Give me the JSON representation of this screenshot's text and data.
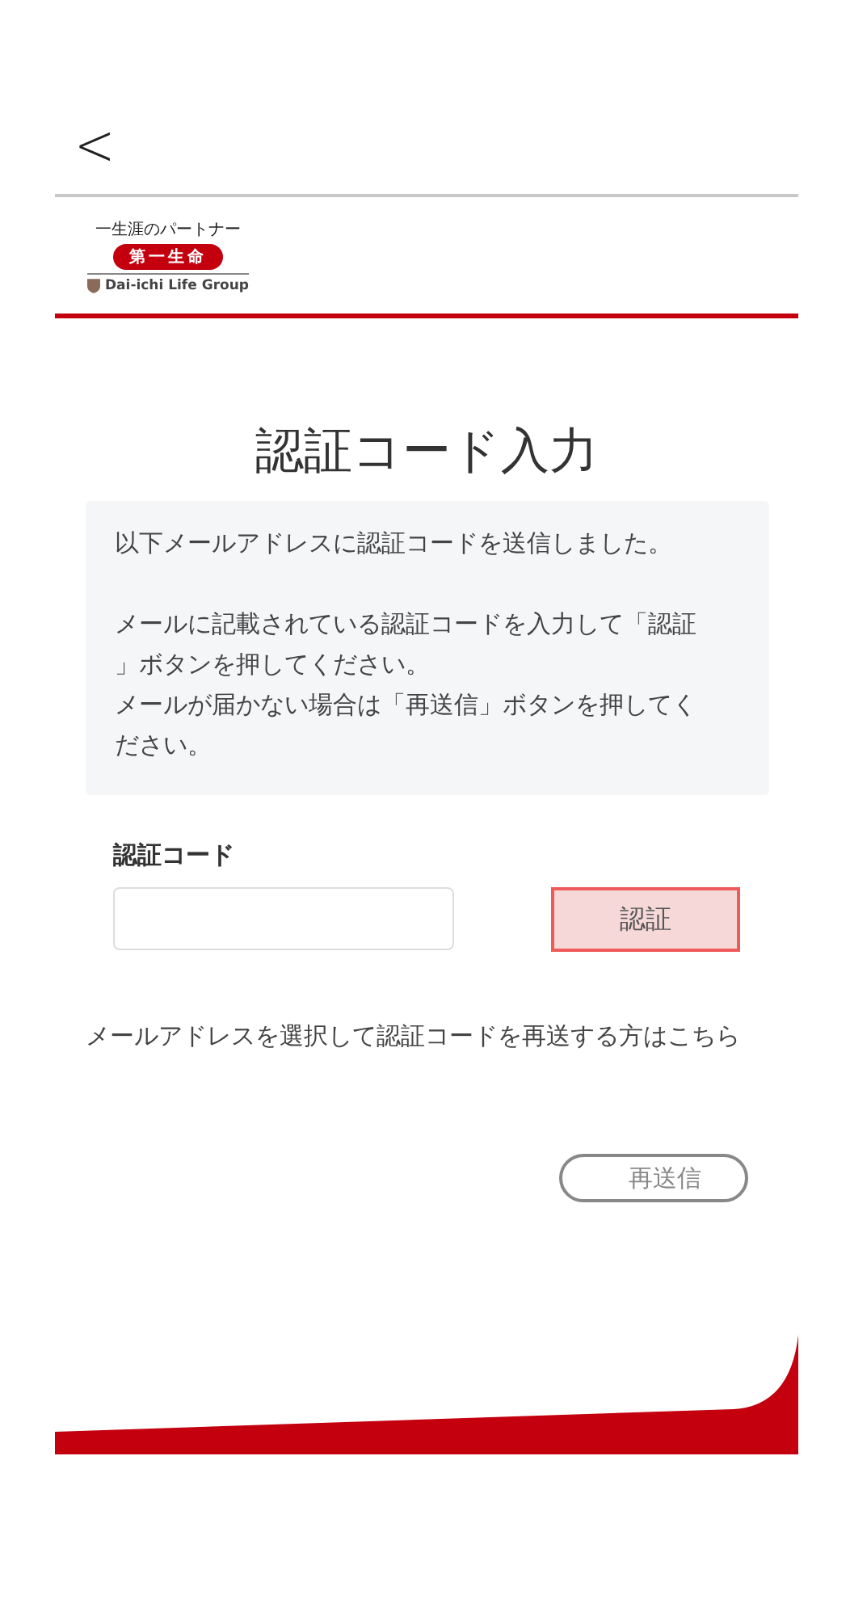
{
  "header": {
    "back": "<"
  },
  "logo": {
    "tagline": "一生涯のパートナー",
    "name": "第一生命",
    "group": "Dai-ichi Life Group"
  },
  "title": "認証コード入力",
  "message": {
    "paragraphs": [
      [
        "以下メールアドレスに認証コードを送信しました。"
      ],
      [
        "メールに記載されている認証コードを入力して「認証」ボタンを押してください。",
        "メールが届かない場合は「再送信」ボタンを押してください。"
      ]
    ]
  },
  "code_field": {
    "label": "認証コード",
    "submit": "認証"
  },
  "reselect_link": "メールアドレスを選択して認証コードを再送する方はこちら",
  "resend_button": "再送信"
}
